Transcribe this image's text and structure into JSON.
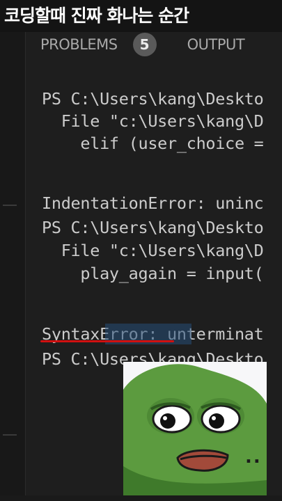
{
  "caption": {
    "text": "코딩할때 진짜 화나는 순간"
  },
  "panel": {
    "tabs": {
      "problems": "PROBLEMS",
      "problems_count": "5",
      "output": "OUTPUT"
    },
    "lines": [
      "PS C:\\Users\\kang\\Deskto",
      "  File \"c:\\Users\\kang\\D",
      "    elif (user_choice =",
      "IndentationError: uninc",
      "PS C:\\Users\\kang\\Deskto",
      "  File \"c:\\Users\\kang\\D",
      "    play_again = input(",
      "SyntaxError: unterminat",
      "PS C:\\Users\\kang\\Deskto"
    ],
    "highlight": "Error: u"
  },
  "meme": {
    "name": "pepe-frog-sticker",
    "dots": "..",
    "skin_color": "#5c9b3f",
    "lip_color": "#a24a3a"
  },
  "colors": {
    "background": "#1e1e1e",
    "text": "#cccccc",
    "selection": "#264f78",
    "underline": "#d01010"
  }
}
